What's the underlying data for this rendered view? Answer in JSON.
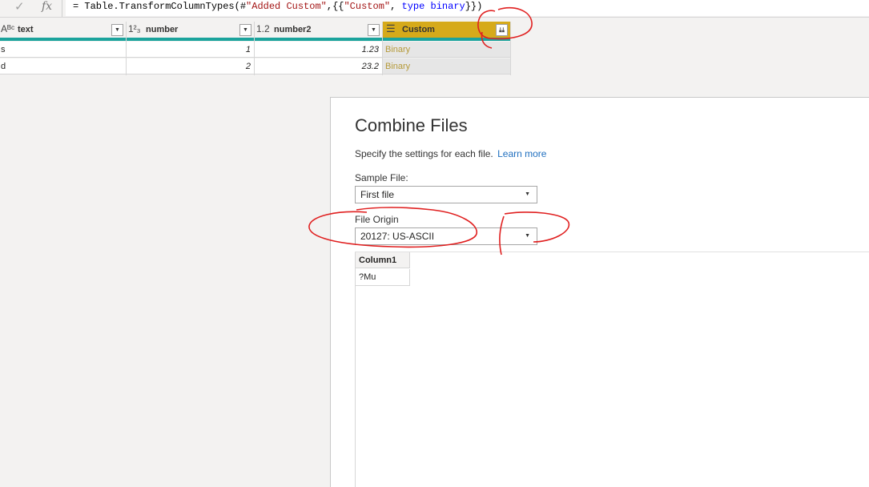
{
  "formula_bar": {
    "formula_prefix": "= Table.TransformColumnTypes(#",
    "formula_str1": "\"Added Custom\"",
    "formula_mid": ",{{",
    "formula_str2": "\"Custom\"",
    "formula_mid2": ", ",
    "formula_kw1": "type",
    "formula_sp": " ",
    "formula_kw2": "binary",
    "formula_suffix": "}})"
  },
  "grid": {
    "columns": [
      {
        "type_icon": "Aᴮᶜ",
        "name": "text"
      },
      {
        "type_icon": "1²₃",
        "name": "number"
      },
      {
        "type_icon": "1.2",
        "name": "number2"
      },
      {
        "type_icon": "☰",
        "name": "Custom"
      }
    ],
    "rows": [
      {
        "text": "s",
        "number": "1",
        "number2": "1.23",
        "custom": "Binary"
      },
      {
        "text": "d",
        "number": "2",
        "number2": "23.2",
        "custom": "Binary"
      }
    ],
    "accent_color": "#1ba39c",
    "selected_column_color": "#d6aa1a"
  },
  "dialog": {
    "title": "Combine Files",
    "description": "Specify the settings for each file.",
    "learn_more": "Learn more",
    "sample_file_label": "Sample File:",
    "sample_file_value": "First file",
    "file_origin_label": "File Origin",
    "file_origin_value": "20127: US-ASCII",
    "preview": {
      "column_header": "Column1",
      "cell": "?Mu"
    }
  }
}
